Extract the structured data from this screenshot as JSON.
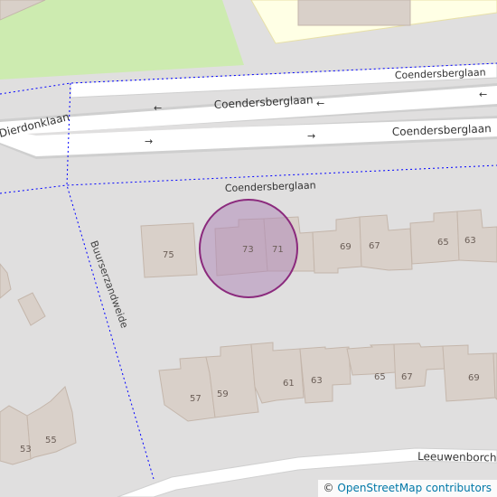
{
  "map": {
    "colors": {
      "background": "#e0dfdf",
      "grass": "#cdebb0",
      "school": "#ffffe5",
      "building": "#d9d0c9",
      "building_stroke": "#c4b6ab",
      "road": "#ffffff",
      "road_casing": "#cfcfcf",
      "path": "#0000ff",
      "marker_fill": "#b08ab8",
      "marker_stroke": "#8b2a7d"
    },
    "streets": {
      "dierdonklaan": "Dierdonklaan",
      "coendersberglaan_top": "Coendersberglaan",
      "coendersberglaan_upper": "Coendersberglaan",
      "coendersberglaan_lower": "Coendersberglaan",
      "coendersberglaan_side": "Coendersberglaan",
      "leeuwenborch": "Leeuwenborchw",
      "buurserzandweide": "Buurserzandweide"
    },
    "house_numbers": {
      "n75": "75",
      "n73": "73",
      "n71": "71",
      "n69a": "69",
      "n67a": "67",
      "n65a": "65",
      "n63a": "63",
      "n57": "57",
      "n59": "59",
      "n61": "61",
      "n63b": "63",
      "n65b": "65",
      "n67b": "67",
      "n69b": "69",
      "n53": "53",
      "n55": "55"
    },
    "marker": {
      "label": "Coendersberglaan 73 highlighted location"
    }
  },
  "attribution": {
    "symbol": "©",
    "text": "OpenStreetMap contributors"
  }
}
